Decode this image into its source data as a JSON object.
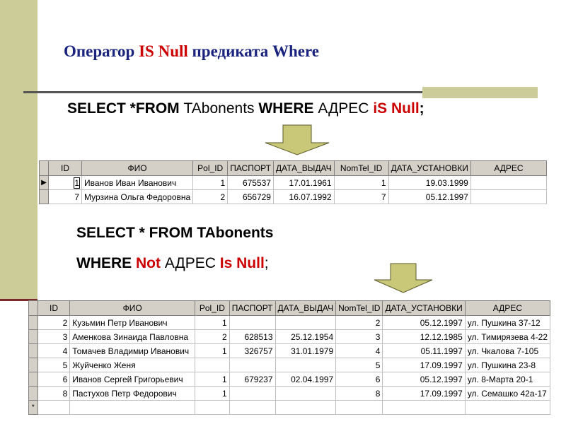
{
  "title": {
    "part1": "Оператор ",
    "highlight": "IS Null",
    "part2": " предиката Where"
  },
  "query1": {
    "select_from": "SELECT *FROM ",
    "table": "TAbonents ",
    "where": "WHERE ",
    "field": "АДРЕС ",
    "cond": "iS Null",
    "end": ";"
  },
  "query2": {
    "line1_select": "SELECT * FROM ",
    "line1_table": "TAbonents",
    "line2_where": "WHERE ",
    "line2_not": "Not",
    "line2_field": " АДРЕС ",
    "line2_cond": "Is Null",
    "line2_end": ";"
  },
  "table1": {
    "columns": [
      "ID",
      "ФИО",
      "Pol_ID",
      "ПАСПОРТ",
      "ДАТА_ВЫДАЧ",
      "NomTel_ID",
      "ДАТА_УСТАНОВКИ",
      "АДРЕС"
    ],
    "rows": [
      {
        "id": "1",
        "fio": "Иванов Иван Иванович",
        "pol": "1",
        "pasp": "675537",
        "data_vyd": "17.01.1961",
        "tel": "1",
        "data_ust": "19.03.1999",
        "adres": ""
      },
      {
        "id": "7",
        "fio": "Мурзина Ольга Федоровна",
        "pol": "2",
        "pasp": "656729",
        "data_vyd": "16.07.1992",
        "tel": "7",
        "data_ust": "05.12.1997",
        "adres": ""
      }
    ]
  },
  "table2": {
    "columns": [
      "ID",
      "ФИО",
      "Pol_ID",
      "ПАСПОРТ",
      "ДАТА_ВЫДАЧ",
      "NomTel_ID",
      "ДАТА_УСТАНОВКИ",
      "АДРЕС"
    ],
    "rows": [
      {
        "id": "2",
        "fio": "Кузьмин Петр Иванович",
        "pol": "1",
        "pasp": "",
        "data_vyd": "",
        "tel": "2",
        "data_ust": "05.12.1997",
        "adres": "ул. Пушкина 37-12"
      },
      {
        "id": "3",
        "fio": "Аменкова Зинаида Павловна",
        "pol": "2",
        "pasp": "628513",
        "data_vyd": "25.12.1954",
        "tel": "3",
        "data_ust": "12.12.1985",
        "adres": "ул. Тимирязева 4-22"
      },
      {
        "id": "4",
        "fio": "Томачев Владимир Иванович",
        "pol": "1",
        "pasp": "326757",
        "data_vyd": "31.01.1979",
        "tel": "4",
        "data_ust": "05.11.1997",
        "adres": "ул. Чкалова 7-105"
      },
      {
        "id": "5",
        "fio": "Жуйченко Женя",
        "pol": "",
        "pasp": "",
        "data_vyd": "",
        "tel": "5",
        "data_ust": "17.09.1997",
        "adres": "ул. Пушкина 23-8"
      },
      {
        "id": "6",
        "fio": "Иванов Сергей Григорьевич",
        "pol": "1",
        "pasp": "679237",
        "data_vyd": "02.04.1997",
        "tel": "6",
        "data_ust": "05.12.1997",
        "adres": "ул. 8-Марта 20-1"
      },
      {
        "id": "8",
        "fio": "Пастухов Петр Федорович",
        "pol": "1",
        "pasp": "",
        "data_vyd": "",
        "tel": "8",
        "data_ust": "17.09.1997",
        "adres": "ул. Семашко 42а-17"
      }
    ]
  },
  "colors": {
    "title": "#1a237e",
    "highlight": "#cc0000",
    "sidebar": "#cccc99",
    "arrow_fill": "#c8c878",
    "arrow_stroke": "#5a5a2a",
    "grid_header": "#d4d0c8"
  }
}
